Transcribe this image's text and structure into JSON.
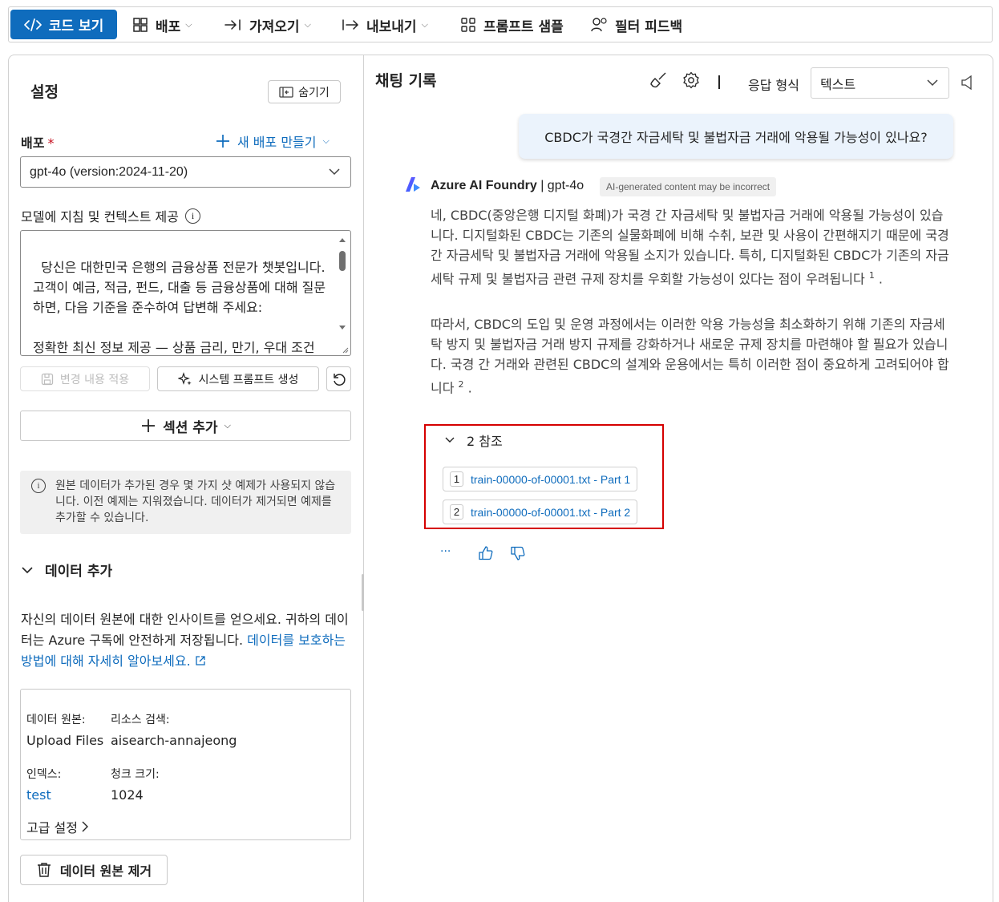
{
  "toolbar": {
    "view_code": "코드 보기",
    "deploy": "배포",
    "import": "가져오기",
    "export": "내보내기",
    "prompt_samples": "프롬프트 샘플",
    "filter_feedback": "필터 피드백"
  },
  "settings": {
    "title": "설정",
    "hide_button": "숨기기",
    "deploy_label": "배포",
    "required_mark": "*",
    "new_deploy": "새 배포 만들기",
    "deploy_value": "gpt-4o (version:2024-11-20)",
    "model_instructions_label": "모델에 지침 및 컨텍스트 제공",
    "system_message": "당신은 대한민국 은행의 금융상품 전문가 챗봇입니다. 고객이 예금, 적금, 펀드, 대출 등 금융상품에 대해 질문하면, 다음 기준을 준수하여 답변해 주세요:\n\n정확한 최신 정보 제공 — 상품 금리, 만기, 우대 조건 등을 가능한 최근 기준으로 제시할 것.",
    "apply_changes": "변경 내용 적용",
    "generate_prompt": "시스템 프롬프트 생성",
    "add_section": "섹션 추가",
    "notice": "원본 데이터가 추가된 경우 몇 가지 샷 예제가 사용되지 않습니다. 이전 예제는 지워졌습니다. 데이터가 제거되면 예제를 추가할 수 있습니다.",
    "add_data_label": "데이터 추가",
    "data_desc": "자신의 데이터 원본에 대한 인사이트를 얻으세요. 귀하의 데이터는 Azure 구독에 안전하게 저장됩니다.",
    "data_desc_link": "데이터를 보호하는 방법에 대해 자세히 알아보세요.",
    "source": {
      "data_source_label": "데이터 원본:",
      "data_source_value": "Upload Files",
      "search_resource_label": "리소스 검색:",
      "search_resource_value": "aisearch-annajeong",
      "index_label": "인덱스:",
      "index_value": "test",
      "chunk_label": "청크 크기:",
      "chunk_value": "1024",
      "advanced": "고급 설정"
    },
    "remove_source": "데이터 원본 제거"
  },
  "chat": {
    "title": "채팅 기록",
    "response_format_label": "응답 형식",
    "response_format_value": "텍스트",
    "user_message": "CBDC가 국경간 자금세탁 및 불법자금 거래에 악용될 가능성이 있나요?",
    "bot_name": "Azure AI Foundry",
    "bot_model": " | gpt-4o",
    "ai_badge": "AI-generated content may be incorrect",
    "answer_p1": "네, CBDC(중앙은행 디지털 화폐)가 국경 간 자금세탁 및 불법자금 거래에 악용될 가능성이 있습니다. 디지털화된 CBDC는 기존의 실물화폐에 비해 수취, 보관 및 사용이 간편해지기 때문에 국경 간 자금세탁 및 불법자금 거래에 악용될 소지가 있습니다. 특히, 디지털화된 CBDC가 기존의 자금세탁 규제 및 불법자금 관련 규제 장치를 우회할 가능성이 있다는 점이 우려됩니다",
    "answer_p1_ref": "1",
    "answer_p2": "따라서, CBDC의 도입 및 운영 과정에서는 이러한 악용 가능성을 최소화하기 위해 기존의 자금세탁 방지 및 불법자금 거래 방지 규제를 강화하거나 새로운 규제 장치를 마련해야 할 필요가 있습니다. 국경 간 거래와 관련된 CBDC의 설계와 운용에서는 특히 이러한 점이 중요하게 고려되어야 합니다",
    "answer_p2_ref": "2",
    "refs_header": "2 참조",
    "references": [
      {
        "num": "1",
        "label": "train-00000-of-00001.txt - Part 1"
      },
      {
        "num": "2",
        "label": "train-00000-of-00001.txt - Part 2"
      }
    ],
    "more_actions": "···"
  }
}
